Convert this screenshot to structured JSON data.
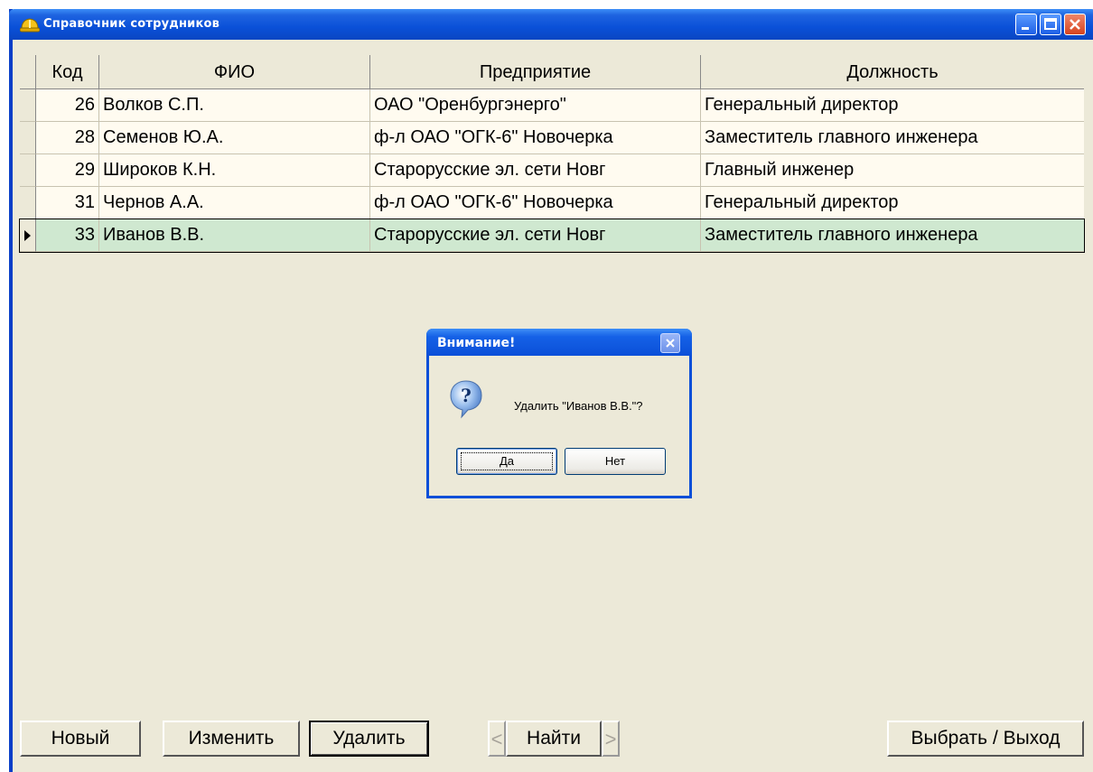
{
  "window": {
    "title": "Справочник сотрудников"
  },
  "grid": {
    "columns": [
      "Код",
      "ФИО",
      "Предприятие",
      "Должность"
    ],
    "rows": [
      {
        "kod": "26",
        "fio": "Волков С.П.",
        "ent": "ОАО \"Оренбургэнерго\"",
        "pos": "Генеральный директор"
      },
      {
        "kod": "28",
        "fio": "Семенов Ю.А.",
        "ent": "ф-л ОАО \"ОГК-6\" Новочерка",
        "pos": "Заместитель главного инженера"
      },
      {
        "kod": "29",
        "fio": "Широков К.Н.",
        "ent": "Старорусские эл. сети Новг",
        "pos": "Главный инженер"
      },
      {
        "kod": "31",
        "fio": "Чернов А.А.",
        "ent": "ф-л ОАО \"ОГК-6\" Новочерка",
        "pos": "Генеральный директор"
      },
      {
        "kod": "33",
        "fio": "Иванов В.В.",
        "ent": "Старорусские эл. сети Новг",
        "pos": "Заместитель главного инженера"
      }
    ],
    "selected_index": 4
  },
  "buttons": {
    "new": "Новый",
    "edit": "Изменить",
    "delete": "Удалить",
    "find": "Найти",
    "find_prev": "<",
    "find_next": ">",
    "select_exit": "Выбрать / Выход"
  },
  "dialog": {
    "title": "Внимание!",
    "message": "Удалить \"Иванов В.В.\"?",
    "yes": "Да",
    "no": "Нет"
  },
  "colors": {
    "titlebar": "#0a50d8",
    "window_bg": "#ece9d8",
    "row_bg": "#fffbf0",
    "selected_row_bg": "#cfe8d0"
  }
}
